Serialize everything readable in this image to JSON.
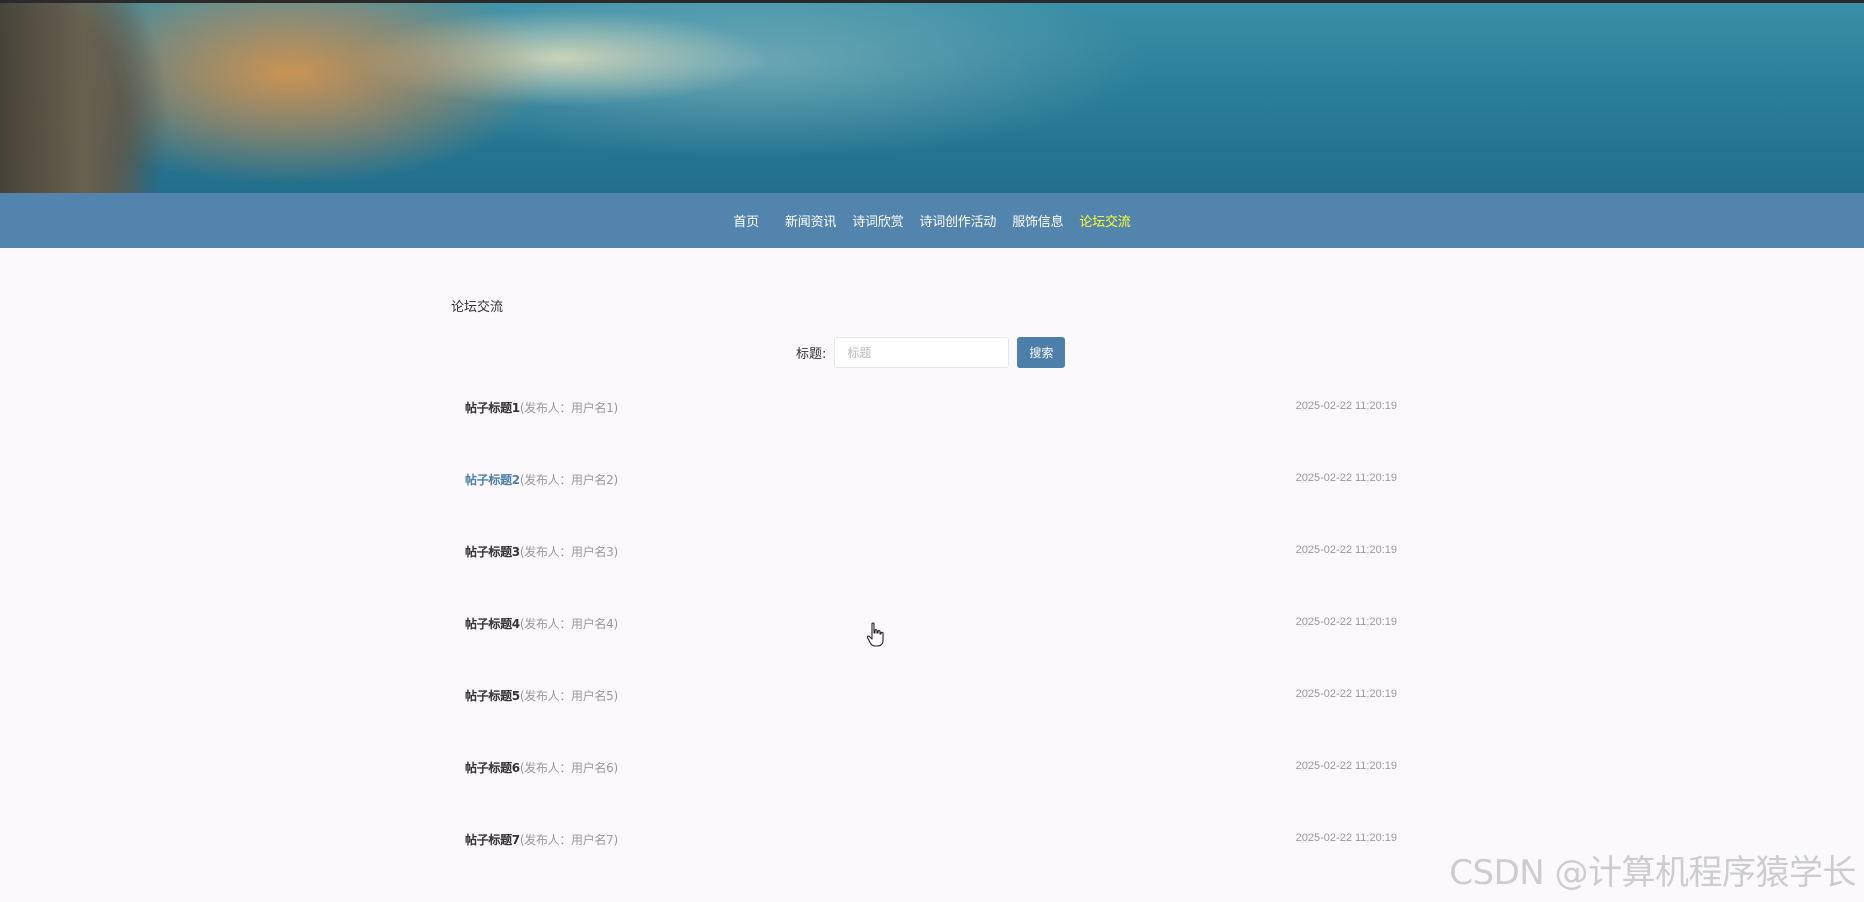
{
  "nav": {
    "items": [
      {
        "label": "首页"
      },
      {
        "label": "新闻资讯"
      },
      {
        "label": "诗词欣赏"
      },
      {
        "label": "诗词创作活动"
      },
      {
        "label": "服饰信息"
      },
      {
        "label": "论坛交流"
      }
    ],
    "active_index": 5,
    "background_color": "#5284ad",
    "active_color": "#ffff33"
  },
  "section": {
    "title": "论坛交流"
  },
  "search": {
    "label": "标题:",
    "placeholder": "标题",
    "value": "",
    "button_label": "搜索"
  },
  "posts": [
    {
      "title": "帖子标题1",
      "author": "(发布人：用户名1)",
      "time": "2025-02-22 11:20:19"
    },
    {
      "title": "帖子标题2",
      "author": "(发布人：用户名2)",
      "time": "2025-02-22 11:20:19"
    },
    {
      "title": "帖子标题3",
      "author": "(发布人：用户名3)",
      "time": "2025-02-22 11:20:19"
    },
    {
      "title": "帖子标题4",
      "author": "(发布人：用户名4)",
      "time": "2025-02-22 11:20:19"
    },
    {
      "title": "帖子标题5",
      "author": "(发布人：用户名5)",
      "time": "2025-02-22 11:20:19"
    },
    {
      "title": "帖子标题6",
      "author": "(发布人：用户名6)",
      "time": "2025-02-22 11:20:19"
    },
    {
      "title": "帖子标题7",
      "author": "(发布人：用户名7)",
      "time": "2025-02-22 11:20:19"
    }
  ],
  "hovered_post_index": 1,
  "watermark": "CSDN @计算机程序猿学长"
}
